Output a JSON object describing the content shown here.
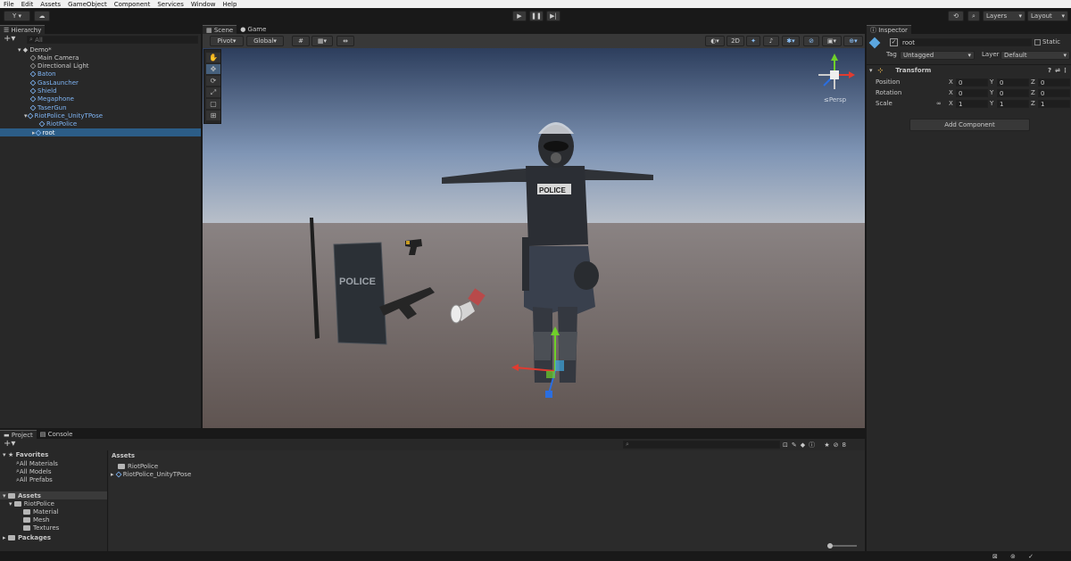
{
  "menu": [
    "File",
    "Edit",
    "Assets",
    "GameObject",
    "Component",
    "Services",
    "Window",
    "Help"
  ],
  "toolbar": {
    "account": "Y ▾",
    "layers": "Layers",
    "layout": "Layout"
  },
  "hierarchy": {
    "tab": "Hierarchy",
    "search": "All",
    "scene": "Demo*",
    "items": [
      {
        "label": "Main Camera",
        "blue": false,
        "indent": 34
      },
      {
        "label": "Directional Light",
        "blue": false,
        "indent": 34
      },
      {
        "label": "Baton",
        "blue": true,
        "indent": 34
      },
      {
        "label": "GasLauncher",
        "blue": true,
        "indent": 34
      },
      {
        "label": "Shield",
        "blue": true,
        "indent": 34
      },
      {
        "label": "Megaphone",
        "blue": true,
        "indent": 34
      },
      {
        "label": "TaserGun",
        "blue": true,
        "indent": 34
      },
      {
        "label": "RiotPolice_UnityTPose",
        "blue": true,
        "indent": 34
      },
      {
        "label": "RiotPolice",
        "blue": true,
        "indent": 44
      },
      {
        "label": "root",
        "blue": true,
        "indent": 44
      }
    ]
  },
  "scene": {
    "tabs": [
      "Scene",
      "Game"
    ],
    "pivot": "Pivot",
    "global": "Global",
    "mode2d": "2D",
    "persp": "≤Persp"
  },
  "inspector": {
    "tab": "Inspector",
    "name": "root",
    "static": "Static",
    "tag_label": "Tag",
    "tag": "Untagged",
    "layer_label": "Layer",
    "layer": "Default",
    "transform": "Transform",
    "rows": [
      {
        "label": "Position",
        "x": "0",
        "y": "0",
        "z": "0"
      },
      {
        "label": "Rotation",
        "x": "0",
        "y": "0",
        "z": "0"
      },
      {
        "label": "Scale",
        "x": "1",
        "y": "1",
        "z": "1"
      }
    ],
    "add_component": "Add Component"
  },
  "project": {
    "tabs": [
      "Project",
      "Console"
    ],
    "favorites": "Favorites",
    "fav_items": [
      "All Materials",
      "All Models",
      "All Prefabs"
    ],
    "assets": "Assets",
    "tree": [
      "RiotPolice",
      "Material",
      "Mesh",
      "Textures"
    ],
    "packages": "Packages",
    "breadcrumb": "Assets",
    "files": [
      "RiotPolice",
      "RiotPolice_UnityTPose"
    ]
  },
  "axes": {
    "x": "X",
    "y": "Y",
    "z": "Z"
  },
  "police_text": "POLICE"
}
